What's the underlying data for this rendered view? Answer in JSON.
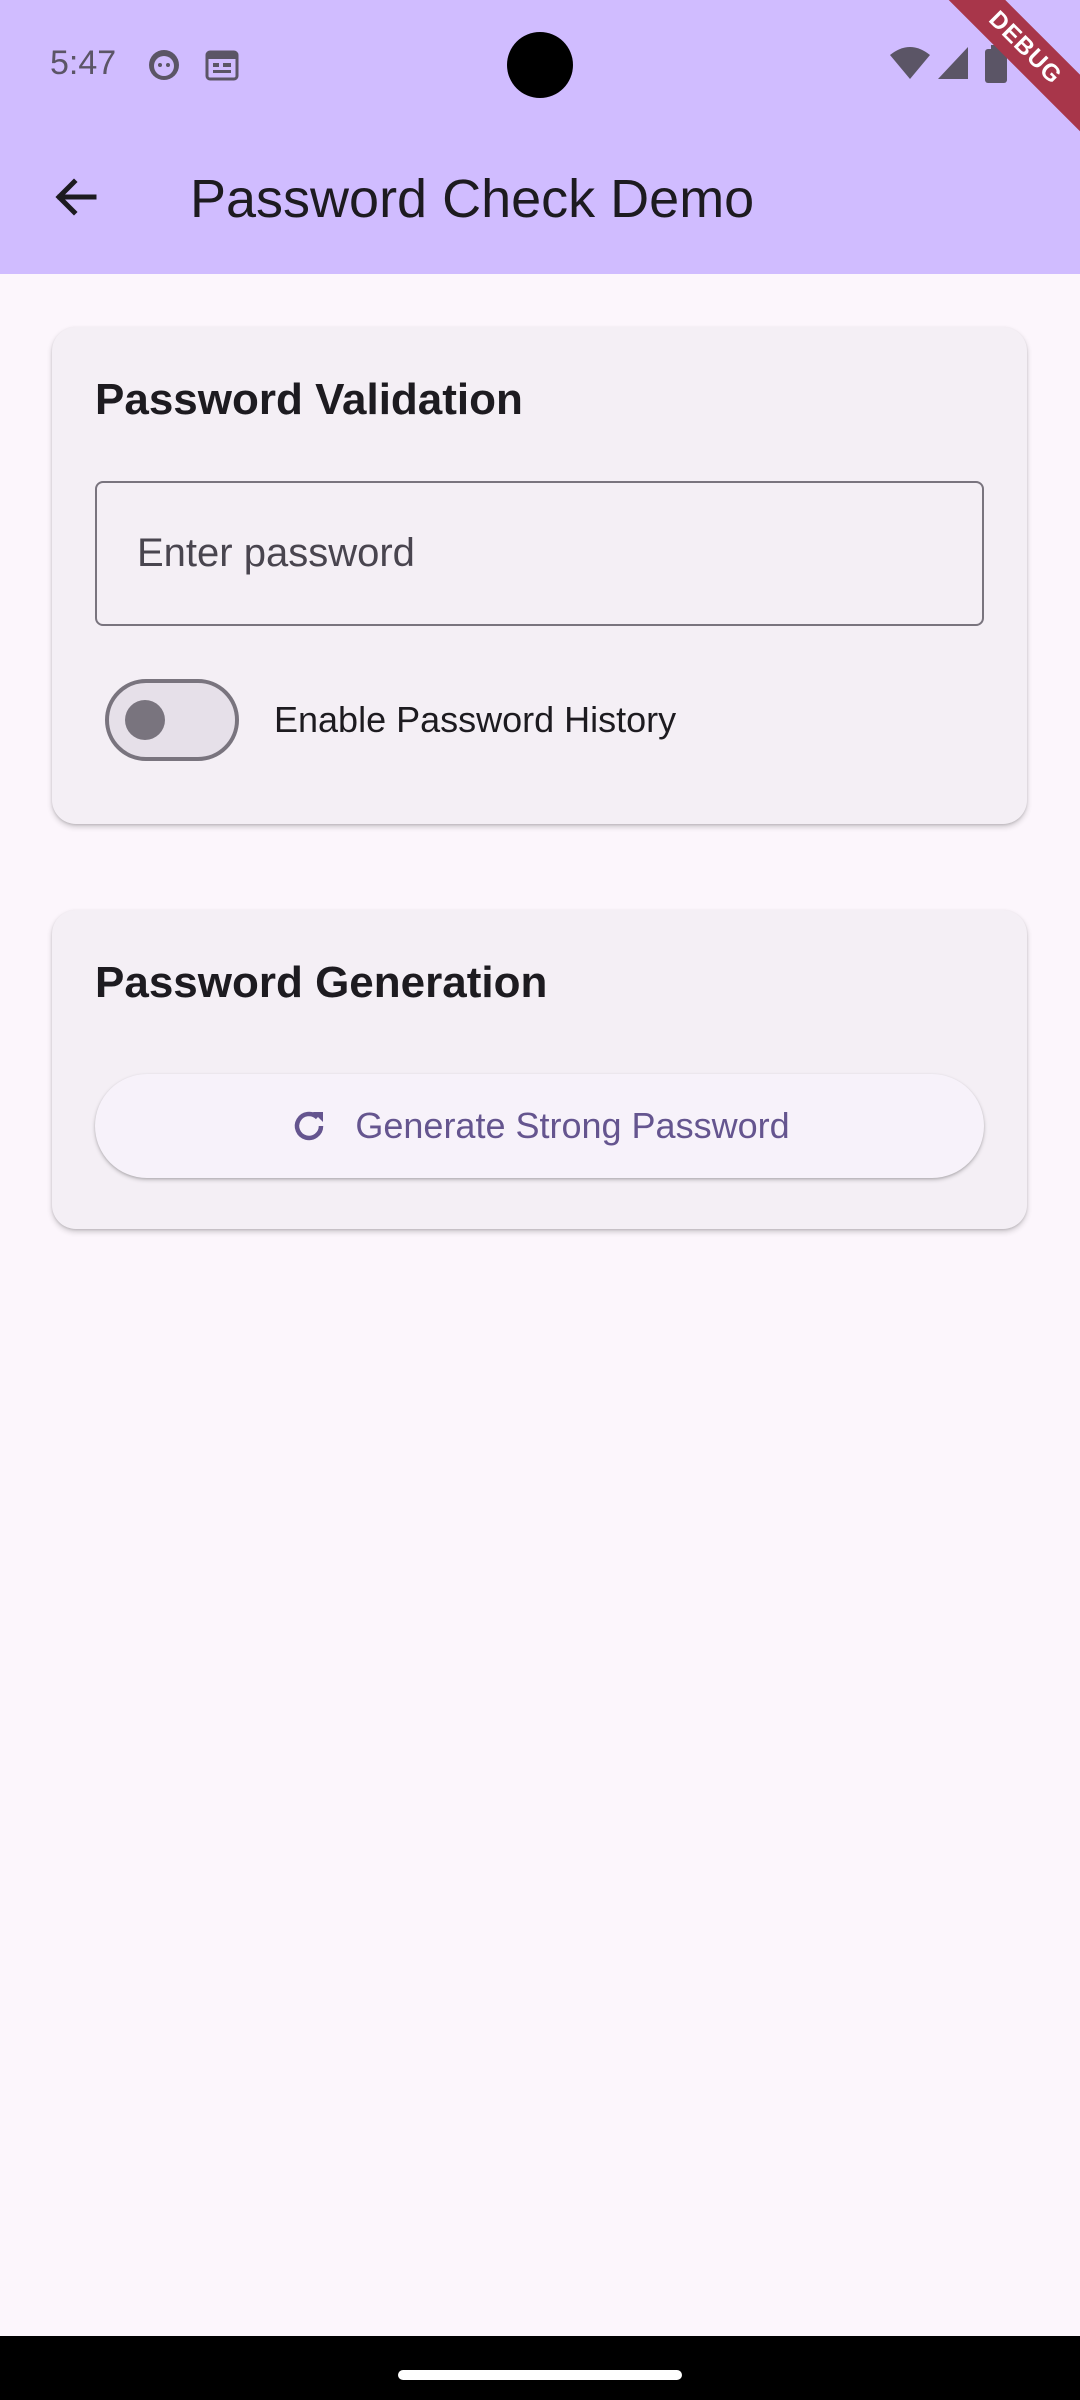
{
  "status_bar": {
    "time": "5:47",
    "left_icons": [
      "cat-face-icon",
      "calendar-icon"
    ],
    "right_icons": [
      "wifi-icon",
      "cellular-signal-icon",
      "battery-icon"
    ]
  },
  "debug_ribbon": "DEBUG",
  "app_bar": {
    "back_icon": "arrow-back-icon",
    "title": "Password Check Demo",
    "color": "#D0BCFF"
  },
  "validation_card": {
    "title": "Password Validation",
    "password_field": {
      "placeholder": "Enter password",
      "value": ""
    },
    "history_toggle": {
      "label": "Enable Password History",
      "on": false
    }
  },
  "generation_card": {
    "title": "Password Generation",
    "generate_button": {
      "icon": "refresh-icon",
      "label": "Generate Strong Password"
    }
  },
  "colors": {
    "background": "#FCF6FC",
    "card": "#F4EFF5",
    "accent": "#65558F",
    "ribbon": "#A8364A"
  }
}
